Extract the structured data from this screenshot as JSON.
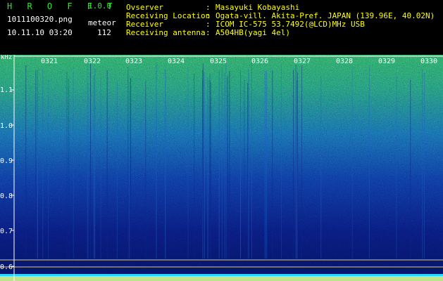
{
  "header": {
    "app_title": "H R O F F T",
    "app_version": "1.0.0",
    "filename": "1011100320.png",
    "mode": "meteor",
    "datetime": "10.11.10 03:20",
    "count": "112",
    "info": [
      {
        "key": "Ovserver",
        "value": "Masayuki Kobayashi"
      },
      {
        "key": "Receiving Location",
        "value": "Ogata-vill. Akita-Pref. JAPAN (139.96E, 40.02N)"
      },
      {
        "key": "Receiver",
        "value": "ICOM IC-575 53.7492(@LCD)MHz USB"
      },
      {
        "key": "Receiving antenna",
        "value": "A504HB(yagi 4el)"
      }
    ]
  },
  "spectrogram": {
    "y_unit": "kHz",
    "y_ticks": [
      "1.1",
      "1.0",
      "0.9",
      "0.8",
      "0.7",
      "0.6"
    ],
    "time_labels": [
      "0321",
      "0322",
      "0323",
      "0324",
      "0325",
      "0326",
      "0327",
      "0328",
      "0329",
      "0330"
    ]
  },
  "colors": {
    "title": "#2ee82e",
    "info": "#ffff00",
    "axis": "#ffffff",
    "baseline": "#ffe85a"
  }
}
